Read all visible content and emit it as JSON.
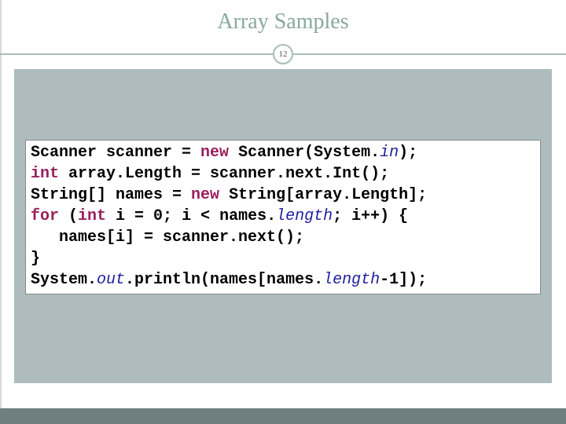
{
  "title": "Array Samples",
  "page_number": "12",
  "code": {
    "line1": {
      "t1": "Scanner scanner = ",
      "kw1": "new",
      "t2": " Scanner(System.",
      "fld1": "in",
      "t3": ");"
    },
    "line2": {
      "kw1": "int",
      "t1": " array.Length = scanner.next.Int();"
    },
    "line3": {
      "t1": "String[] names = ",
      "kw1": "new",
      "t2": " String[array.Length];"
    },
    "line4": {
      "kw1": "for",
      "t1": " (",
      "kw2": "int",
      "t2": " i = 0; i < names.",
      "fld1": "length",
      "t3": "; i++) {"
    },
    "line5": {
      "t1": "   names[i] = scanner.next();"
    },
    "line6": {
      "t1": "}"
    },
    "line7": {
      "t1": "System.",
      "fld1": "out",
      "t2": ".println(names[names.",
      "fld2": "length",
      "t3": "-1]);"
    }
  }
}
